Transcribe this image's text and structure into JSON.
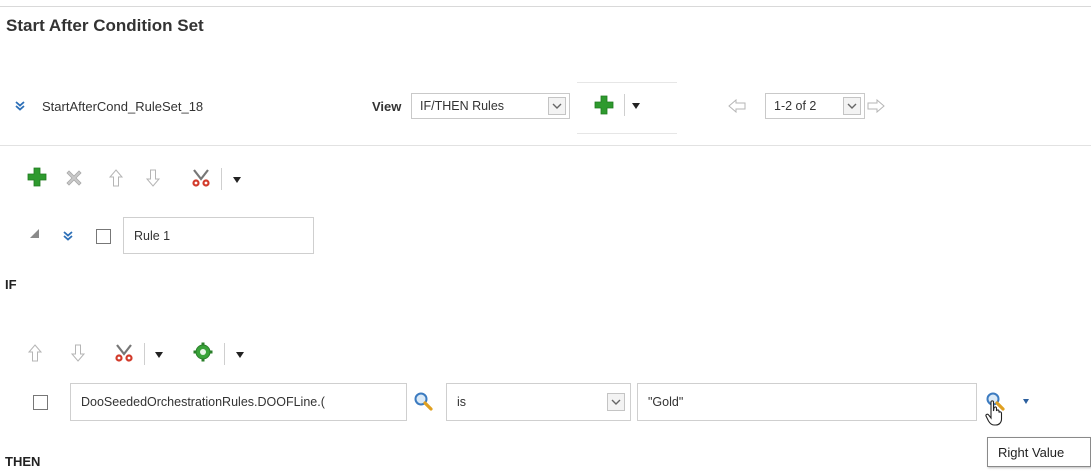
{
  "page": {
    "title": "Start After Condition Set"
  },
  "ruleset": {
    "name": "StartAfterCond_RuleSet_18",
    "view_label": "View",
    "view_value": "IF/THEN Rules",
    "pagination_value": "1-2 of 2"
  },
  "rule": {
    "name": "Rule 1"
  },
  "sections": {
    "if_label": "IF",
    "then_label": "THEN"
  },
  "condition": {
    "left_value": "DooSeededOrchestrationRules.DOOFLine.(",
    "operator": "is",
    "right_value": "\"Gold\""
  },
  "tooltip": {
    "text": "Right Value"
  },
  "colors": {
    "accent_green": "#2e9a2e",
    "delete_red": "#d23c2c",
    "link_blue": "#2c6fb7",
    "gear_green": "#39a339"
  }
}
